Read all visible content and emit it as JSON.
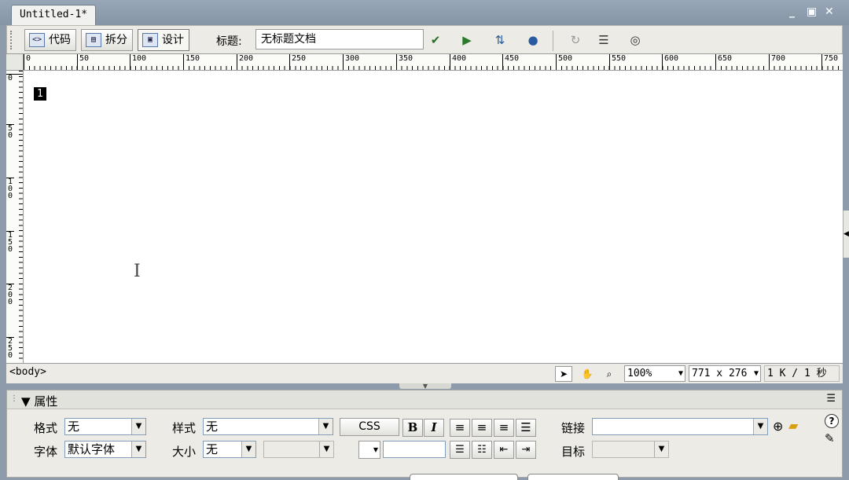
{
  "document": {
    "tab_title": "Untitled-1*"
  },
  "window_controls": {
    "minimize": "_",
    "restore": "▣",
    "close": "✕"
  },
  "toolbar": {
    "views": [
      {
        "label": "代码",
        "icon": "code-view-icon",
        "glyph": "<>"
      },
      {
        "label": "拆分",
        "icon": "split-view-icon",
        "glyph": "▤"
      },
      {
        "label": "设计",
        "icon": "design-view-icon",
        "glyph": "▣"
      }
    ],
    "active_view": "设计",
    "title_label": "标题:",
    "title_value": "无标题文档",
    "icons": [
      "validate-markup-icon",
      "preview-in-browser-icon",
      "file-management-icon",
      "browser-check-icon",
      "refresh-icon",
      "view-options-icon",
      "visual-aids-icon"
    ]
  },
  "ruler": {
    "horizontal_labels": [
      "0",
      "50",
      "100",
      "150",
      "200",
      "250",
      "300",
      "350",
      "400",
      "450",
      "500",
      "550",
      "600",
      "650",
      "700",
      "750"
    ],
    "vertical_labels": [
      "0",
      "50",
      "100",
      "150",
      "200",
      "250"
    ]
  },
  "canvas": {
    "cursor_text": "1"
  },
  "statusbar": {
    "tag_selector": "<body>",
    "zoom": "100%",
    "window_size": "771 x 276",
    "download_stats": "1 K / 1 秒"
  },
  "properties": {
    "title": "属性",
    "format_label": "格式",
    "format_value": "无",
    "style_label": "样式",
    "style_value": "无",
    "css_button": "CSS",
    "bold": "B",
    "italic": "I",
    "link_label": "链接",
    "link_value": "",
    "font_label": "字体",
    "font_value": "默认字体",
    "size_label": "大小",
    "size_value": "无",
    "target_label": "目标",
    "target_value": "",
    "color_value": ""
  },
  "colors": {
    "window_bg": "#8d9bab",
    "panel_bg": "#ecebe6",
    "canvas_bg": "#ffffff"
  }
}
